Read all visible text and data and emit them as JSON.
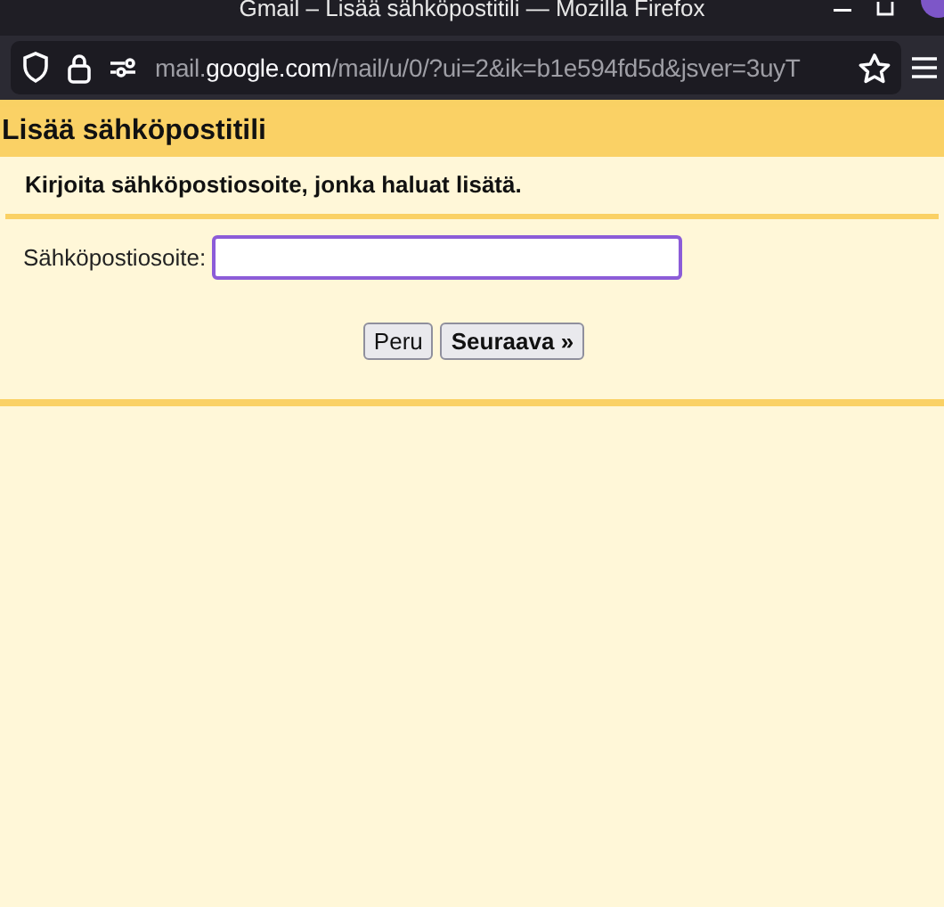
{
  "window": {
    "title": "Gmail – Lisää sähköpostitili — Mozilla Firefox"
  },
  "address_bar": {
    "url_prefix": "mail.",
    "url_domain": "google.com",
    "url_path": "/mail/u/0/?ui=2&ik=b1e594fd5d&jsver=3uyT"
  },
  "page": {
    "heading": "Lisää sähköpostitili",
    "instruction": "Kirjoita sähköpostiosoite, jonka haluat lisätä.",
    "field_label": "Sähköpostiosoite:",
    "field_focused": true,
    "buttons": [
      {
        "label": "Peru",
        "kind": "normal"
      },
      {
        "label": "Seuraava »",
        "kind": "primary"
      }
    ]
  }
}
